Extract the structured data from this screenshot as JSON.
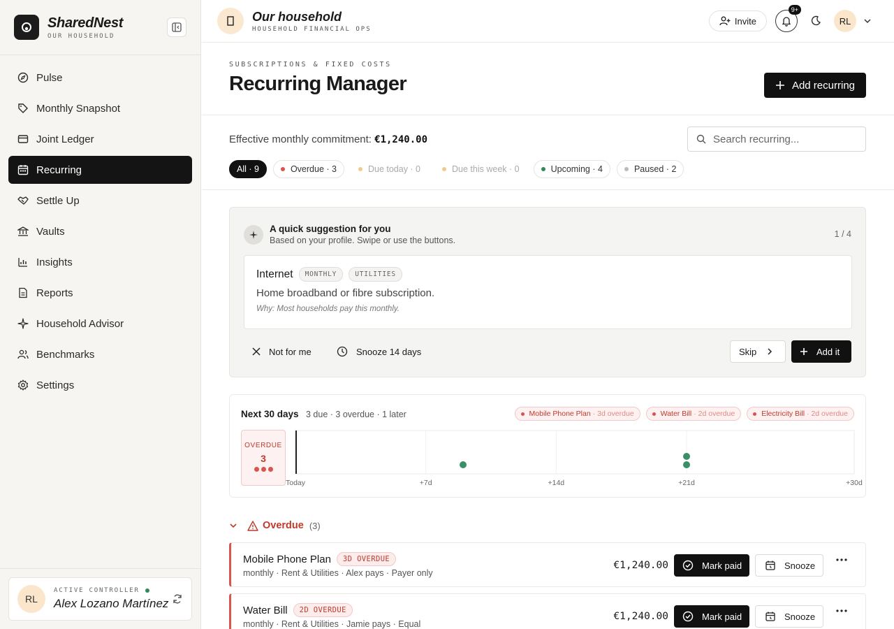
{
  "brand": {
    "name": "SharedNest",
    "sub": "OUR HOUSEHOLD"
  },
  "nav": [
    {
      "label": "Pulse",
      "icon": "compass-icon"
    },
    {
      "label": "Monthly Snapshot",
      "icon": "tag-icon"
    },
    {
      "label": "Joint Ledger",
      "icon": "card-icon"
    },
    {
      "label": "Recurring",
      "icon": "calendar-icon",
      "active": true
    },
    {
      "label": "Settle Up",
      "icon": "handshake-icon"
    },
    {
      "label": "Vaults",
      "icon": "bank-icon"
    },
    {
      "label": "Insights",
      "icon": "chart-icon"
    },
    {
      "label": "Reports",
      "icon": "document-icon"
    },
    {
      "label": "Household Advisor",
      "icon": "sparkle-icon"
    },
    {
      "label": "Benchmarks",
      "icon": "users-icon"
    },
    {
      "label": "Settings",
      "icon": "gear-icon"
    }
  ],
  "controller": {
    "initials": "RL",
    "label": "ACTIVE CONTROLLER",
    "name": "Alex Lozano Martínez"
  },
  "topbar": {
    "title": "Our household",
    "sub": "HOUSEHOLD FINANCIAL OPS",
    "invite": "Invite",
    "badge": "9+",
    "user_initials": "RL"
  },
  "header": {
    "eyebrow": "SUBSCRIPTIONS & FIXED COSTS",
    "title": "Recurring Manager",
    "add_label": "Add recurring"
  },
  "filters": {
    "commit_label": "Effective monthly commitment:",
    "commit_amount": "€1,240.00",
    "search_placeholder": "Search recurring...",
    "chips": [
      {
        "label": "All · 9",
        "state": "active"
      },
      {
        "label": "Overdue · 3",
        "dot": "#d9534f"
      },
      {
        "label": "Due today · 0",
        "dot": "#f3c98b",
        "state": "muted"
      },
      {
        "label": "Due this week · 0",
        "dot": "#f3c98b",
        "state": "muted"
      },
      {
        "label": "Upcoming · 4",
        "dot": "#2e8b57"
      },
      {
        "label": "Paused · 2",
        "dot": "#bbbbbb"
      }
    ]
  },
  "suggestion": {
    "title": "A quick suggestion for you",
    "sub": "Based on your profile. Swipe or use the buttons.",
    "count": "1 / 4",
    "name": "Internet",
    "tags": [
      "MONTHLY",
      "UTILITIES"
    ],
    "desc": "Home broadband or fibre subscription.",
    "why": "Why: Most households pay this monthly.",
    "not_for_me": "Not for me",
    "snooze": "Snooze 14 days",
    "skip": "Skip",
    "add": "Add it"
  },
  "timeline": {
    "title": "Next 30 days",
    "sub": "3 due · 3 overdue · 1 later",
    "pills": [
      {
        "name": "Mobile Phone Plan",
        "status": "· 3d overdue"
      },
      {
        "name": "Water Bill",
        "status": "· 2d overdue"
      },
      {
        "name": "Electricity Bill",
        "status": "· 2d overdue"
      }
    ],
    "overdue_label": "OVERDUE",
    "overdue_count": "3",
    "ticks": [
      "Today",
      "+7d",
      "+14d",
      "+21d",
      "+30d"
    ],
    "tick_days": [
      0,
      7,
      14,
      21,
      30
    ],
    "items_days": [
      9,
      21,
      21
    ],
    "dot_color": "#3a8f66"
  },
  "overdue": {
    "label": "Overdue",
    "count": "(3)",
    "rows": [
      {
        "name": "Mobile Phone Plan",
        "badge": "3D OVERDUE",
        "meta": "monthly · Rent & Utilities · Alex pays · Payer only",
        "amount": "€1,240.00",
        "paid": "Mark paid",
        "snooze": "Snooze"
      },
      {
        "name": "Water Bill",
        "badge": "2D OVERDUE",
        "meta": "monthly · Rent & Utilities · Jamie pays · Equal",
        "amount": "€1,240.00",
        "paid": "Mark paid",
        "snooze": "Snooze"
      }
    ]
  }
}
